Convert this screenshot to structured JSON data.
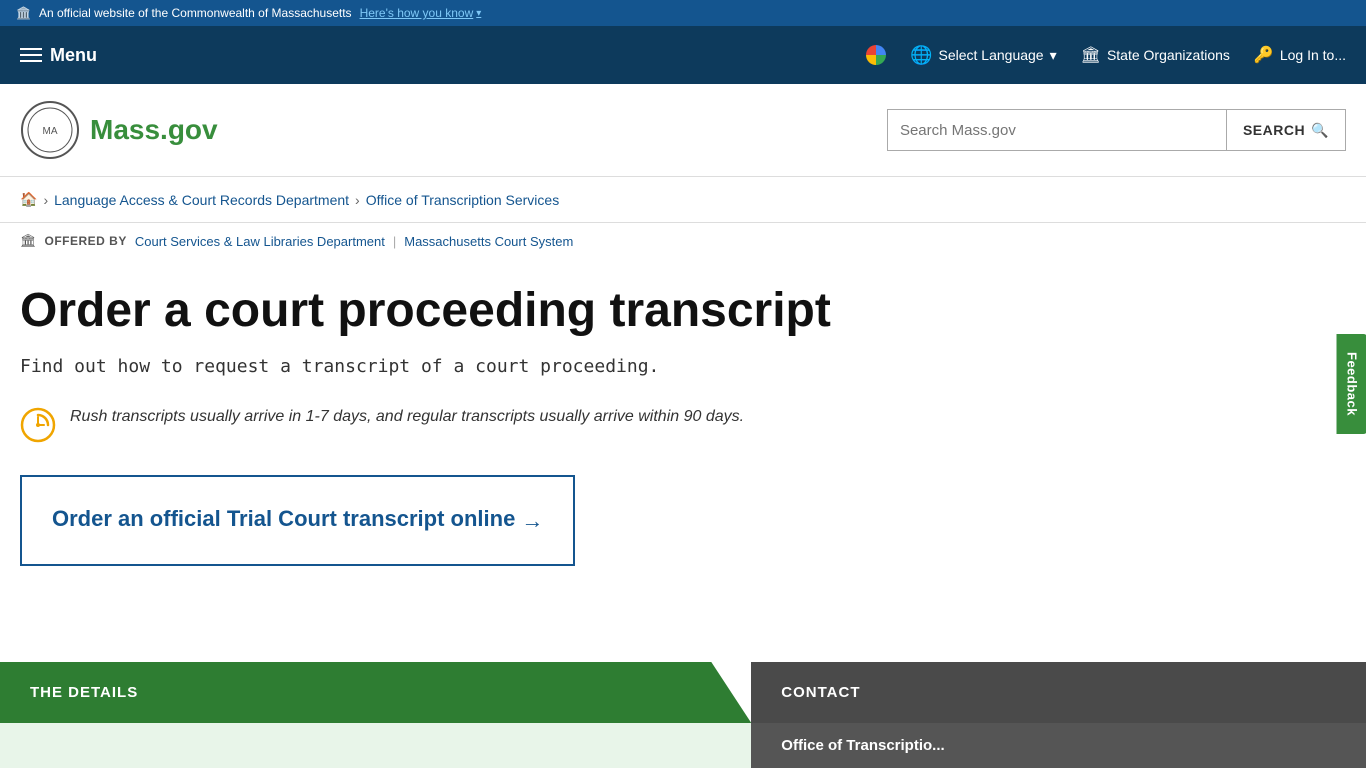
{
  "top_banner": {
    "official_text": "An official website of the Commonwealth of Massachusetts",
    "heres_how_text": "Here's how you know"
  },
  "nav": {
    "menu_label": "Menu",
    "select_language": "Select Language",
    "state_organizations": "State Organizations",
    "log_in": "Log In to..."
  },
  "header": {
    "logo_text": "Mass.gov",
    "search_placeholder": "Search Mass.gov",
    "search_button": "SEARCH"
  },
  "breadcrumb": {
    "home_label": "Home",
    "level1": "Language Access & Court Records Department",
    "level2": "Office of Transcription Services"
  },
  "offered_by": {
    "label": "OFFERED BY",
    "org1": "Court Services & Law Libraries Department",
    "divider": "|",
    "org2": "Massachusetts Court System"
  },
  "main": {
    "page_title": "Order a court proceeding transcript",
    "page_subtitle": "Find out how to request a transcript of a court proceeding.",
    "info_text": "Rush transcripts usually arrive in 1-7 days, and regular transcripts usually arrive within 90 days.",
    "cta_text": "Order an official Trial Court transcript online",
    "cta_arrow": "→"
  },
  "footer_tabs": {
    "details_label": "THE DETAILS",
    "contact_label": "CONTACT",
    "contact_sub": "Office of Transcriptio..."
  },
  "feedback": {
    "label": "Feedback"
  }
}
